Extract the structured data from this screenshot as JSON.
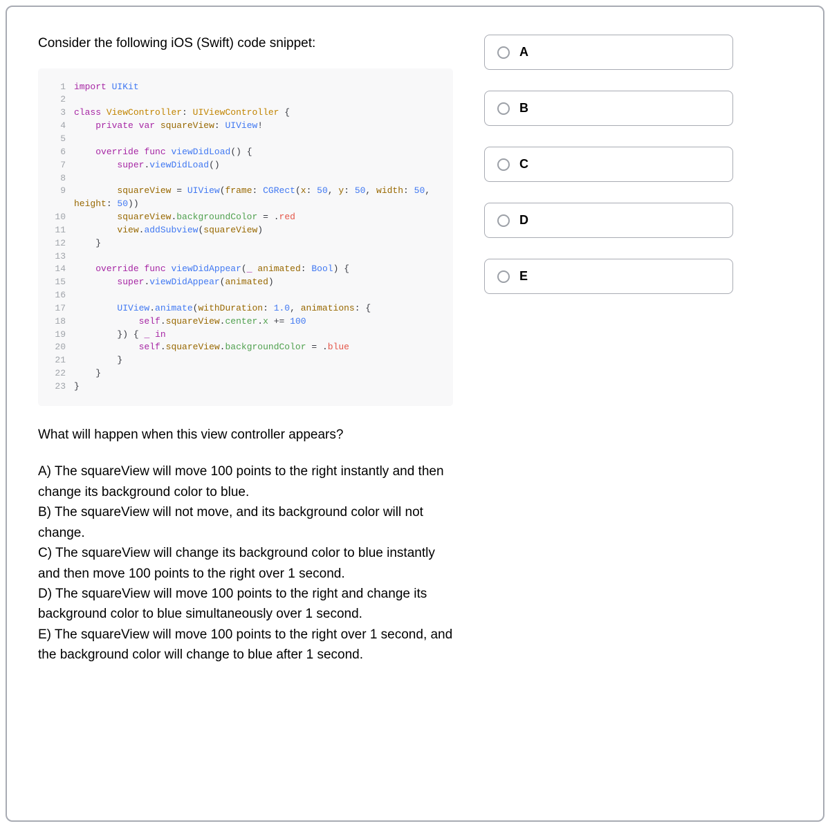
{
  "prompt": "Consider the following iOS (Swift) code snippet:",
  "code": {
    "lines": [
      {
        "no": "1",
        "html": "<span class='c-keyword'>import</span> <span class='c-type'>UIKit</span>"
      },
      {
        "no": "2",
        "html": ""
      },
      {
        "no": "3",
        "html": "<span class='c-keyword'>class</span> <span class='c-class'>ViewController</span><span class='c-text'>: </span><span class='c-class'>UIViewController</span> <span class='c-brace'>{</span>"
      },
      {
        "no": "4",
        "html": "    <span class='c-keyword'>private</span> <span class='c-keyword'>var</span> <span class='c-var'>squareView</span><span class='c-text'>: </span><span class='c-type'>UIView</span><span class='c-text'>!</span>"
      },
      {
        "no": "5",
        "html": ""
      },
      {
        "no": "6",
        "html": "    <span class='c-keyword'>override</span> <span class='c-keyword'>func</span> <span class='c-func'>viewDidLoad</span><span class='c-brace'>() {</span>"
      },
      {
        "no": "7",
        "html": "        <span class='c-keyword'>super</span><span class='c-dot'>.</span><span class='c-func'>viewDidLoad</span><span class='c-brace'>()</span>"
      },
      {
        "no": "8",
        "html": ""
      },
      {
        "no": "9",
        "html": "        <span class='c-var'>squareView</span> <span class='c-text'>=</span> <span class='c-type'>UIView</span><span class='c-brace'>(</span><span class='c-param'>frame</span><span class='c-text'>: </span><span class='c-type'>CGRect</span><span class='c-brace'>(</span><span class='c-param'>x</span><span class='c-text'>: </span><span class='c-num'>50</span><span class='c-text'>, </span><span class='c-param'>y</span><span class='c-text'>: </span><span class='c-num'>50</span><span class='c-text'>, </span><span class='c-param'>width</span><span class='c-text'>: </span><span class='c-num'>50</span><span class='c-text'>, </span><span class='c-param'>height</span><span class='c-text'>: </span><span class='c-num'>50</span><span class='c-brace'>))</span>"
      },
      {
        "no": "10",
        "html": "        <span class='c-var'>squareView</span><span class='c-dot'>.</span><span class='c-prop'>backgroundColor</span> <span class='c-text'>=</span> <span class='c-dot'>.</span><span class='c-enum'>red</span>"
      },
      {
        "no": "11",
        "html": "        <span class='c-var'>view</span><span class='c-dot'>.</span><span class='c-func'>addSubview</span><span class='c-brace'>(</span><span class='c-var'>squareView</span><span class='c-brace'>)</span>"
      },
      {
        "no": "12",
        "html": "    <span class='c-brace'>}</span>"
      },
      {
        "no": "13",
        "html": ""
      },
      {
        "no": "14",
        "html": "    <span class='c-keyword'>override</span> <span class='c-keyword'>func</span> <span class='c-func'>viewDidAppear</span><span class='c-brace'>(</span><span class='c-keyword'>_</span> <span class='c-param'>animated</span><span class='c-text'>: </span><span class='c-type'>Bool</span><span class='c-brace'>) {</span>"
      },
      {
        "no": "15",
        "html": "        <span class='c-keyword'>super</span><span class='c-dot'>.</span><span class='c-func'>viewDidAppear</span><span class='c-brace'>(</span><span class='c-var'>animated</span><span class='c-brace'>)</span>"
      },
      {
        "no": "16",
        "html": ""
      },
      {
        "no": "17",
        "html": "        <span class='c-type'>UIView</span><span class='c-dot'>.</span><span class='c-func'>animate</span><span class='c-brace'>(</span><span class='c-param'>withDuration</span><span class='c-text'>: </span><span class='c-num'>1.0</span><span class='c-text'>, </span><span class='c-param'>animations</span><span class='c-text'>: </span><span class='c-brace'>{</span>"
      },
      {
        "no": "18",
        "html": "            <span class='c-keyword'>self</span><span class='c-dot'>.</span><span class='c-var'>squareView</span><span class='c-dot'>.</span><span class='c-prop'>center</span><span class='c-dot'>.</span><span class='c-prop'>x</span> <span class='c-text'>+=</span> <span class='c-num'>100</span>"
      },
      {
        "no": "19",
        "html": "        <span class='c-brace'>}) {</span> <span class='c-keyword'>_</span> <span class='c-keyword'>in</span>"
      },
      {
        "no": "20",
        "html": "            <span class='c-keyword'>self</span><span class='c-dot'>.</span><span class='c-var'>squareView</span><span class='c-dot'>.</span><span class='c-prop'>backgroundColor</span> <span class='c-text'>=</span> <span class='c-dot'>.</span><span class='c-enum'>blue</span>"
      },
      {
        "no": "21",
        "html": "        <span class='c-brace'>}</span>"
      },
      {
        "no": "22",
        "html": "    <span class='c-brace'>}</span>"
      },
      {
        "no": "23",
        "html": "<span class='c-brace'>}</span>"
      }
    ]
  },
  "question": "What will happen when this view controller appears?",
  "answers": {
    "A": "A) The squareView will move 100 points to the right instantly and then change its background color to blue.",
    "B": "B) The squareView will not move, and its background color will not change.",
    "C": "C) The squareView will change its background color to blue instantly and then move 100 points to the right over 1 second.",
    "D": "D) The squareView will move 100 points to the right and change its background color to blue simultaneously over 1 second.",
    "E": "E) The squareView will move 100 points to the right over 1 second, and the background color will change to blue after 1 second."
  },
  "options": [
    {
      "label": "A"
    },
    {
      "label": "B"
    },
    {
      "label": "C"
    },
    {
      "label": "D"
    },
    {
      "label": "E"
    }
  ]
}
